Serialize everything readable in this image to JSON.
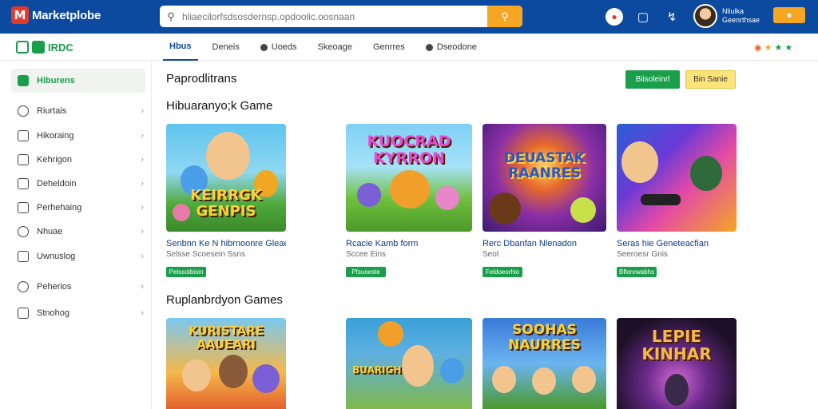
{
  "header": {
    "logo_letter": "M",
    "logo_text": "Marketplobe",
    "search_placeholder": "hliaecilorfsdsosdernsp.opdoolic.oosnaan",
    "user_name_line1": "Nliulka",
    "user_name_line2": "Geenrthsae"
  },
  "subnav": {
    "brand": "IRDC",
    "tabs": [
      {
        "label": "Hbus",
        "active": true
      },
      {
        "label": "Deneis"
      },
      {
        "label": "Uoeds"
      },
      {
        "label": "Skeoage"
      },
      {
        "label": "Genrres"
      },
      {
        "label": "Dseodone"
      }
    ]
  },
  "sidebar": {
    "items": [
      {
        "label": "Hiburens",
        "active": true
      },
      {
        "label": "Riurtais"
      },
      {
        "label": "Hikoraing"
      },
      {
        "label": "Kehrigon"
      },
      {
        "label": "Deheldoin"
      },
      {
        "label": "Perhehaing"
      },
      {
        "label": "Nhuae"
      },
      {
        "label": "Uwnuslog"
      },
      {
        "label": "Peherios"
      },
      {
        "label": "Stnohog"
      }
    ]
  },
  "main": {
    "page_title": "Paprodlitrans",
    "btn_primary": "Biisoleinrl",
    "btn_secondary": "Bin Sanie",
    "section1_title": "Hibuaranyo;k Game",
    "section2_title": "Ruplanbrdyon Games",
    "row1": [
      {
        "art": "KEIRRGK GENPIS",
        "title": "Senbnn Ke N hibrnoonre Gleaens",
        "subtitle": "Selsse Scoesein Ssns",
        "badge": "Pelssotbisin"
      },
      {
        "art": "KUOCRAD KYRRON",
        "title": "Rcacie Kamb form",
        "subtitle": "Sccee Eins",
        "badge": "Pfsuoeste"
      },
      {
        "art": "DEUASTAK RAANRES",
        "title": "Rerc Dbanfan Nlenadon",
        "subtitle": "Seot",
        "badge": "Feldoeorhio"
      },
      {
        "art": "",
        "title": "Seras hie Geneteacfian",
        "subtitle": "Seeroesr Gnis",
        "badge": "Bflonrwabhs"
      }
    ],
    "row2": [
      {
        "art": "KURISTARE AAUEARI"
      },
      {
        "art": "BUARIGHE"
      },
      {
        "art": "SOOHAS NAURRES"
      },
      {
        "art": "LEPIE KINHAR"
      }
    ]
  }
}
